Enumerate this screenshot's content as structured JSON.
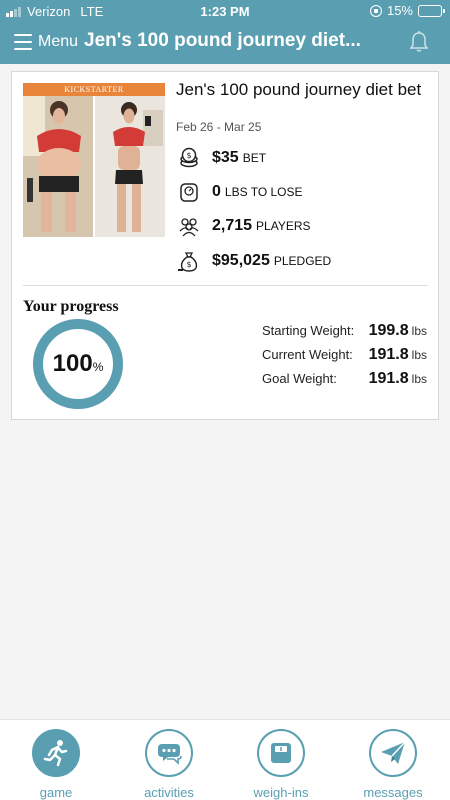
{
  "status_bar": {
    "carrier": "Verizon",
    "network": "LTE",
    "time": "1:23 PM",
    "battery": "15%",
    "battery_level": 0.15,
    "battery_color": "#e8413b"
  },
  "nav": {
    "menu_label": "Menu",
    "title": "Jen's 100 pound journey diet...",
    "bell_icon": "bell-icon"
  },
  "game": {
    "photo_banner": "KICKSTARTER",
    "title": "Jen's 100 pound journey diet bet",
    "dates": "Feb 26 - Mar 25",
    "stats": [
      {
        "icon": "coin-stack-icon",
        "value": "$35",
        "unit": "BET"
      },
      {
        "icon": "scale-icon",
        "value": "0",
        "unit": "LBS TO LOSE"
      },
      {
        "icon": "players-icon",
        "value": "2,715",
        "unit": "PLAYERS"
      },
      {
        "icon": "money-bag-icon",
        "value": "$95,025",
        "unit": "PLEDGED"
      }
    ]
  },
  "progress": {
    "label": "Your progress",
    "percent_value": "100",
    "percent_sign": "%",
    "level": 1.0,
    "weights": [
      {
        "label": "Starting Weight:",
        "value": "199.8",
        "unit": "lbs"
      },
      {
        "label": "Current Weight:",
        "value": "191.8",
        "unit": "lbs"
      },
      {
        "label": "Goal Weight:",
        "value": "191.8",
        "unit": "lbs"
      }
    ]
  },
  "tabs": [
    {
      "label": "game",
      "icon": "running-person-icon",
      "active": true
    },
    {
      "label": "activities",
      "icon": "chat-bubbles-icon",
      "active": false
    },
    {
      "label": "weigh-ins",
      "icon": "scale-icon",
      "active": false
    },
    {
      "label": "messages",
      "icon": "paper-plane-icon",
      "active": false
    }
  ],
  "colors": {
    "accent": "#5a9fb1",
    "background": "#f4f4f4"
  }
}
